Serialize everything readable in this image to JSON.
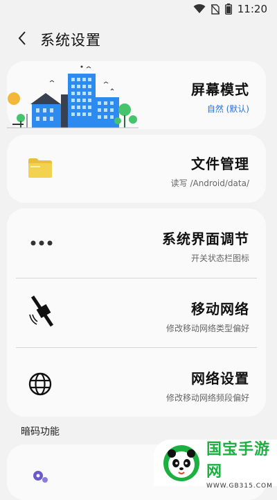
{
  "status_bar": {
    "time": "11:20",
    "icons": [
      "wifi-icon",
      "no-sim-icon",
      "battery-icon"
    ]
  },
  "header": {
    "back_icon": "back-arrow-icon",
    "title": "系统设置"
  },
  "cards": [
    {
      "items": [
        {
          "icon": "city-illustration-icon",
          "title": "屏幕模式",
          "subtitle": "自然 (默认)"
        }
      ]
    },
    {
      "items": [
        {
          "icon": "folder-icon",
          "title": "文件管理",
          "subtitle": "读写 /Android/data/"
        }
      ]
    },
    {
      "items": [
        {
          "icon": "more-dots-icon",
          "title": "系统界面调节",
          "subtitle": "开关状态栏图标"
        },
        {
          "icon": "satellite-icon",
          "title": "移动网络",
          "subtitle": "修改移动网络类型偏好"
        },
        {
          "icon": "globe-icon",
          "title": "网络设置",
          "subtitle": "修改移动网络频段偏好"
        }
      ]
    }
  ],
  "section": {
    "label": "暗码功能"
  },
  "colors": {
    "background": "#f2f2f2",
    "card": "#fafafa",
    "accent": "#2a6fd6",
    "folder": "#f3d24f",
    "building_blue": "#2d8bf0",
    "watermark_green": "#1bb040"
  },
  "watermark": {
    "brand": "国宝手游网",
    "url": "WWW.GB315.COM"
  }
}
